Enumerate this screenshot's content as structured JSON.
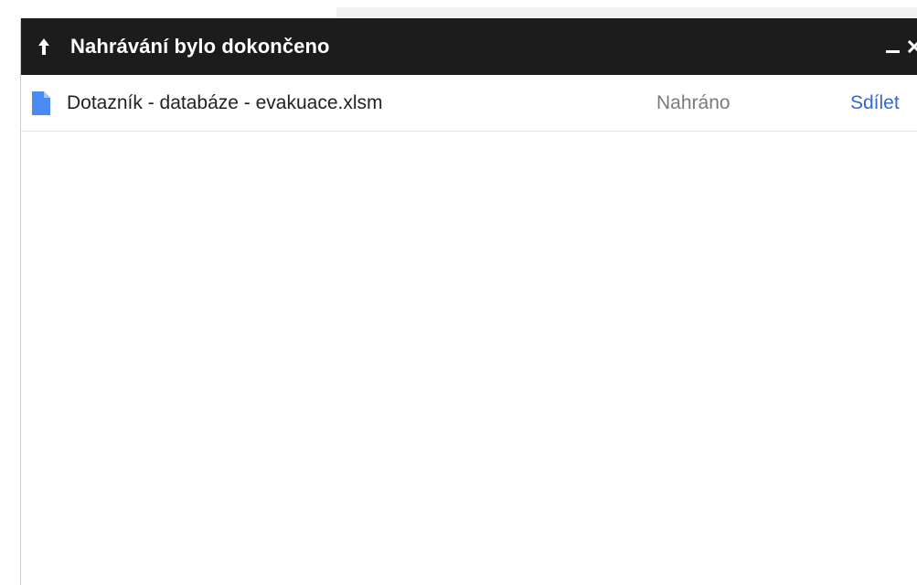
{
  "dialog": {
    "title": "Nahrávání bylo dokončeno",
    "header_bg": "#1c1c1c",
    "icons": {
      "upload": "upload-arrow-icon",
      "minimize": "minimize-icon",
      "close": "close-icon"
    }
  },
  "uploads": [
    {
      "file_name": "Dotazník - databáze - evakuace.xlsm",
      "file_icon": "document-icon",
      "status": "Nahráno",
      "action": "Sdílet",
      "accent": "#3367d6"
    }
  ]
}
